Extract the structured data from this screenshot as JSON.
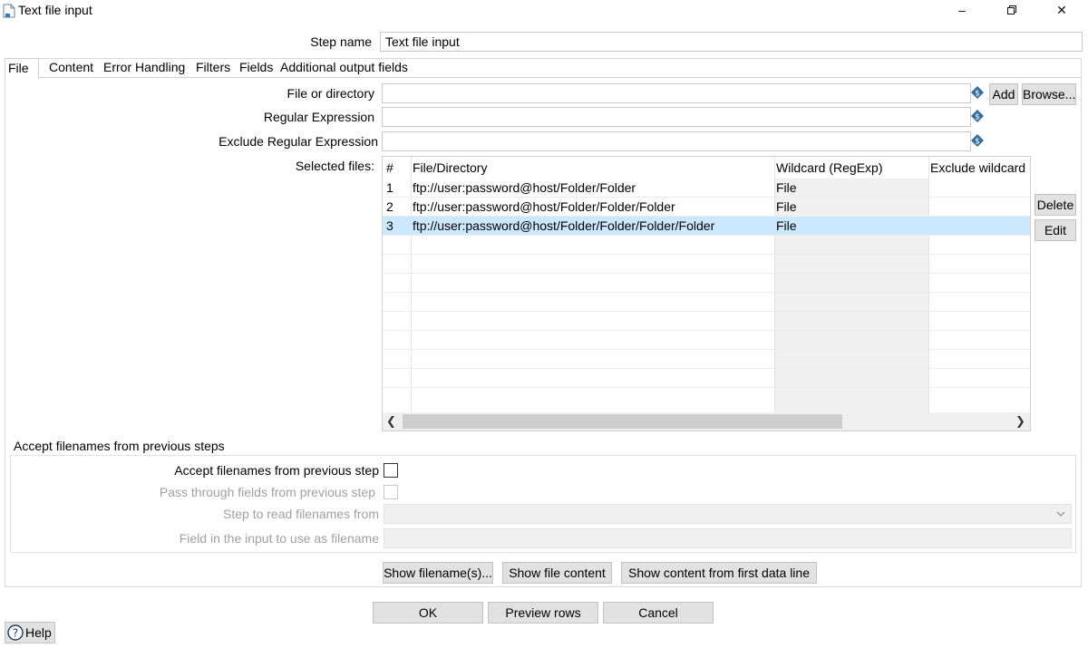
{
  "window": {
    "title": "Text file input"
  },
  "step": {
    "label": "Step name",
    "value": "Text file input"
  },
  "tabs": [
    "File",
    "Content",
    "Error Handling",
    "Filters",
    "Fields",
    "Additional output fields"
  ],
  "file_section": {
    "file_or_dir_label": "File or directory",
    "regex_label": "Regular Expression",
    "exclude_regex_label": "Exclude Regular Expression",
    "selected_files_label": "Selected files:",
    "add_label": "Add",
    "browse_label": "Browse...",
    "delete_label": "Delete",
    "edit_label": "Edit"
  },
  "files_table": {
    "columns": [
      "#",
      "File/Directory",
      "Wildcard (RegExp)",
      "Exclude wildcard"
    ],
    "rows": [
      {
        "num": "1",
        "path": "ftp://user:password@host/Folder/Folder",
        "wildcard": "File",
        "exclude": ""
      },
      {
        "num": "2",
        "path": "ftp://user:password@host/Folder/Folder/Folder",
        "wildcard": "File",
        "exclude": ""
      },
      {
        "num": "3",
        "path": "ftp://user:password@host/Folder/Folder/Folder/Folder",
        "wildcard": "File",
        "exclude": ""
      }
    ],
    "selected_row": 3
  },
  "accept_group": {
    "title": "Accept filenames from previous steps",
    "accept_label": "Accept filenames from previous step",
    "pass_through_label": "Pass through fields from previous step",
    "step_to_read_label": "Step to read filenames from",
    "field_label": "Field in the input to use as filename"
  },
  "actions": {
    "show_filenames": "Show filename(s)...",
    "show_file_content": "Show file content",
    "show_content_first_line": "Show content from first data line"
  },
  "footer": {
    "ok": "OK",
    "preview": "Preview rows",
    "cancel": "Cancel",
    "help": "Help"
  },
  "colors": {
    "selection": "#cce8ff",
    "variable_icon": "#2f6f9f",
    "button_bg": "#e1e1e1"
  },
  "icons": [
    "file-icon",
    "minimize-icon",
    "restore-icon",
    "close-icon",
    "variable-icon",
    "scroll-left-icon",
    "scroll-right-icon",
    "dropdown-icon",
    "help-icon"
  ]
}
